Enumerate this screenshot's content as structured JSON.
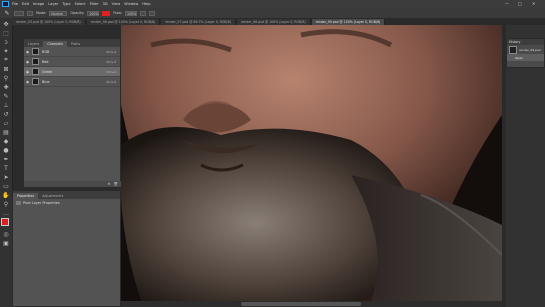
{
  "menubar": {
    "items": [
      "File",
      "Edit",
      "Image",
      "Layer",
      "Type",
      "Select",
      "Filter",
      "3D",
      "View",
      "Window",
      "Help"
    ],
    "window_controls": [
      "—",
      "□",
      "✕"
    ]
  },
  "options": {
    "mode_label": "Mode:",
    "mode_value": "Normal",
    "opacity_label": "Opacity:",
    "opacity_value": "100%",
    "flow_label": "Flow:",
    "flow_value": "100%"
  },
  "tabs": [
    {
      "label": "render_05.psd @ 100% (Layer 0, RGB/8)",
      "active": false
    },
    {
      "label": "render_06.psd @ 100% (Layer 0, RGB/8)",
      "active": false
    },
    {
      "label": "render_07.psd @ 66.7% (Layer 0, RGB/8)",
      "active": false
    },
    {
      "label": "render_08.psd @ 100% (Layer 0, RGB/8)",
      "active": false
    },
    {
      "label": "render_09.psd @ 100% (Layer 0, RGB/8)",
      "active": true
    }
  ],
  "channels_panel": {
    "tabs": [
      "Layers",
      "Channels",
      "Paths"
    ],
    "active_tab": "Channels",
    "rows": [
      {
        "name": "RGB",
        "shortcut": "Ctrl+2",
        "selected": false
      },
      {
        "name": "Red",
        "shortcut": "Ctrl+3",
        "selected": false
      },
      {
        "name": "Green",
        "shortcut": "Ctrl+4",
        "selected": true
      },
      {
        "name": "Blue",
        "shortcut": "Ctrl+5",
        "selected": false
      }
    ]
  },
  "properties_panel": {
    "tabs": [
      "Properties",
      "Adjustments"
    ],
    "active_tab": "Properties",
    "item_label": "Pixel Layer Properties"
  },
  "history_panel": {
    "title": "History",
    "items": [
      "render_09.psd",
      "Open"
    ]
  },
  "colors": {
    "accent": "#31a8ff",
    "foreground_swatch": "#e02020"
  }
}
